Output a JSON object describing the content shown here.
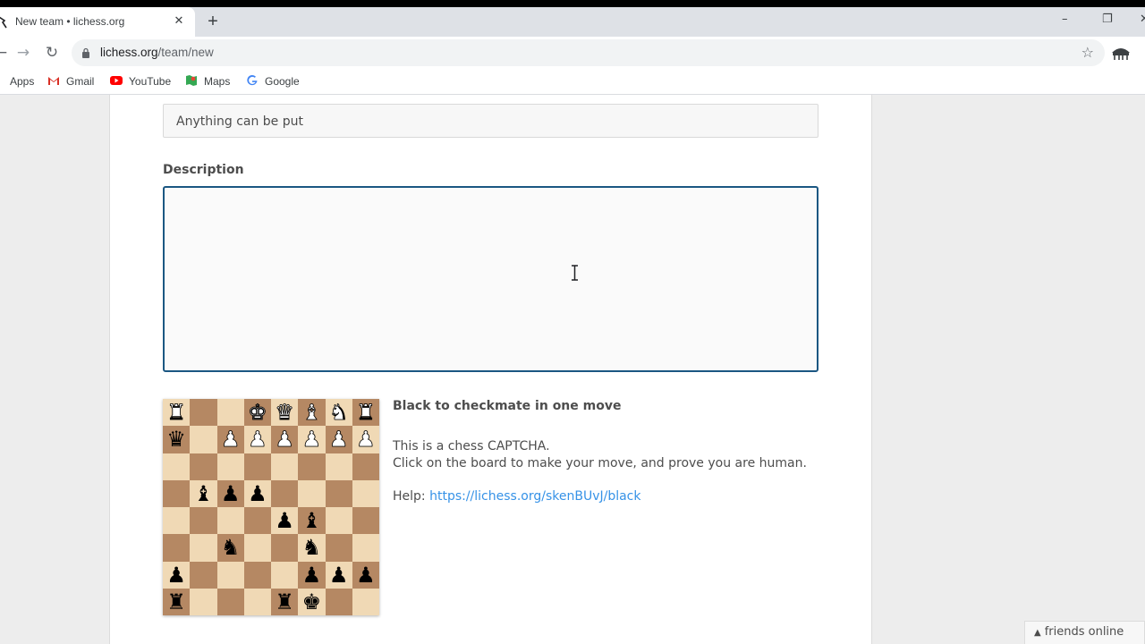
{
  "browser": {
    "tab_title": "New team • lichess.org",
    "tab_close": "✕",
    "new_tab": "+",
    "window_controls": {
      "minimize": "–",
      "restore": "❐",
      "close": "✕"
    },
    "url_host": "lichess.org",
    "url_path": "/team/new",
    "bookmarks": [
      {
        "label": "Apps",
        "icon": "apps-icon"
      },
      {
        "label": "Gmail",
        "icon": "gmail-icon"
      },
      {
        "label": "YouTube",
        "icon": "youtube-icon"
      },
      {
        "label": "Maps",
        "icon": "maps-icon"
      },
      {
        "label": "Google",
        "icon": "google-icon"
      }
    ]
  },
  "form": {
    "name_value": "Anything can be put",
    "description_label": "Description",
    "description_value": ""
  },
  "captcha": {
    "title": "Black to checkmate in one move",
    "line1": "This is a chess CAPTCHA.",
    "line2": "Click on the board to make your move, and prove you are human.",
    "help_label": "Help: ",
    "help_link": "https://lichess.org/skenBUvJ/black",
    "board_rows": [
      [
        "wR",
        "",
        "",
        "wK",
        "wQ",
        "wB",
        "wN",
        "wR"
      ],
      [
        "bQ",
        "",
        "wP",
        "wP",
        "wP",
        "wP",
        "wP",
        "wP"
      ],
      [
        "",
        "",
        "",
        "",
        "",
        "",
        "",
        ""
      ],
      [
        "",
        "bB",
        "bP",
        "bP",
        "",
        "",
        "",
        ""
      ],
      [
        "",
        "",
        "",
        "",
        "bP",
        "bB",
        "",
        ""
      ],
      [
        "",
        "",
        "bN",
        "",
        "",
        "bN",
        "",
        ""
      ],
      [
        "bP",
        "",
        "",
        "",
        "",
        "bP",
        "bP",
        "bP"
      ],
      [
        "bR",
        "",
        "",
        "",
        "bR",
        "bK",
        "",
        ""
      ]
    ]
  },
  "friends_bar": {
    "label": "friends online"
  },
  "colors": {
    "board_light": "#f0d9b5",
    "board_dark": "#b58863",
    "focus_border": "#1b5782",
    "link": "#3692e7"
  }
}
